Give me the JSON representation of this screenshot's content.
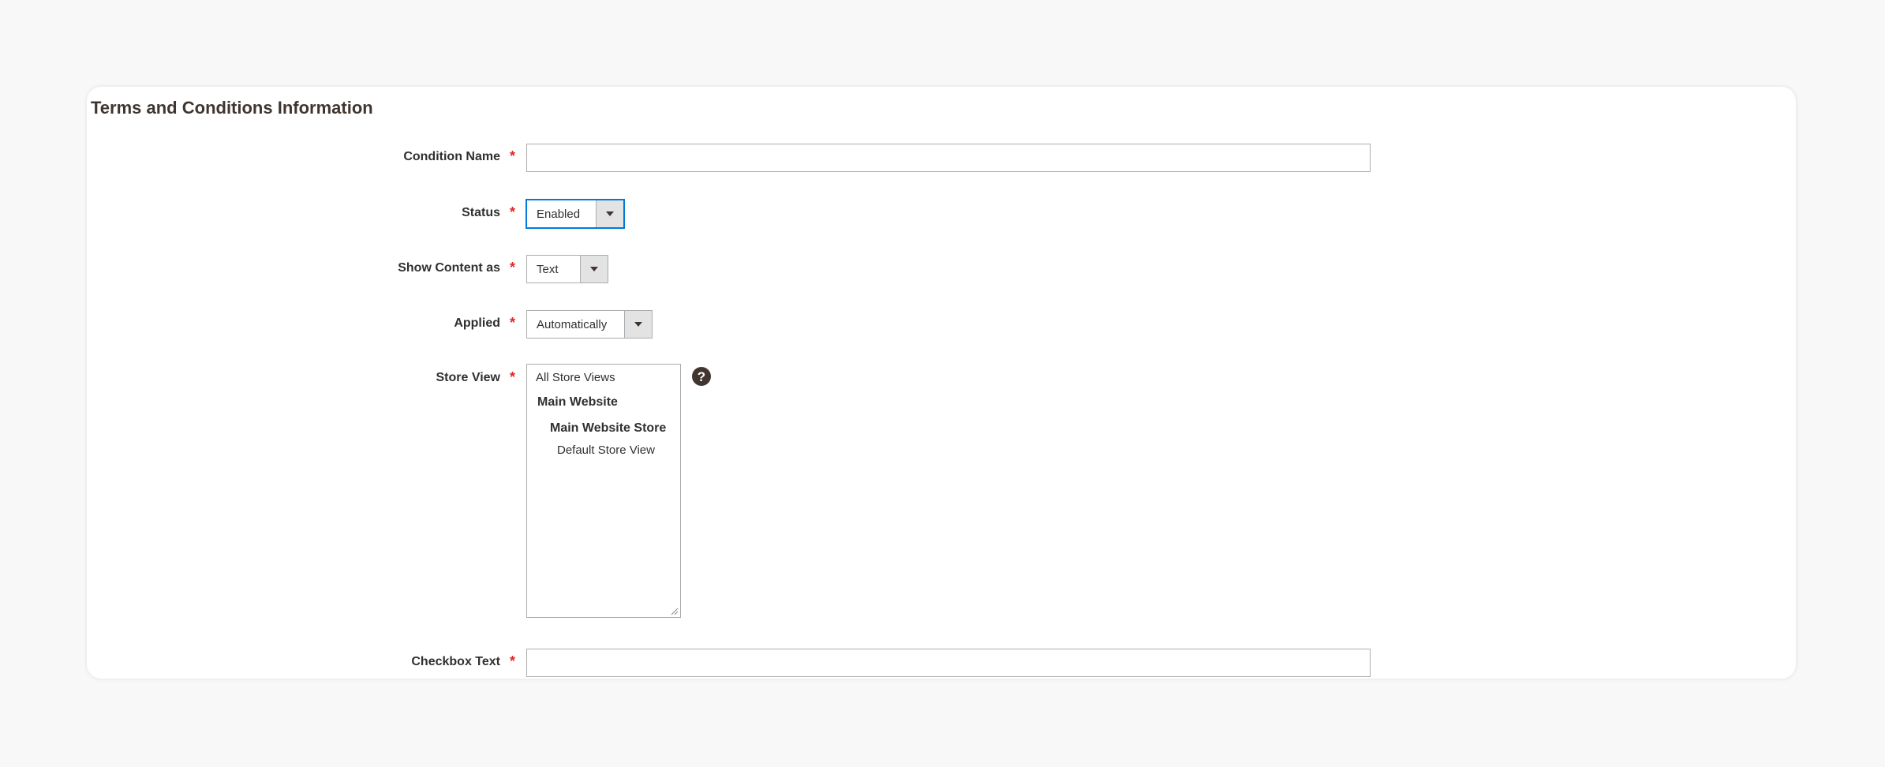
{
  "section": {
    "title": "Terms and Conditions Information"
  },
  "fields": {
    "condition_name": {
      "label": "Condition Name",
      "required_mark": "*",
      "value": ""
    },
    "status": {
      "label": "Status",
      "required_mark": "*",
      "value": "Enabled"
    },
    "show_content_as": {
      "label": "Show Content as",
      "required_mark": "*",
      "value": "Text"
    },
    "applied": {
      "label": "Applied",
      "required_mark": "*",
      "value": "Automatically"
    },
    "store_view": {
      "label": "Store View",
      "required_mark": "*",
      "help": "?",
      "options": [
        "All Store Views",
        "Main Website",
        "Main Website Store",
        "Default Store View"
      ]
    },
    "checkbox_text": {
      "label": "Checkbox Text",
      "required_mark": "*",
      "value": ""
    }
  },
  "colors": {
    "required": "#e22626",
    "focus": "#007bdb",
    "title": "#41362f"
  },
  "icons": {
    "dropdown": "chevron-down-icon",
    "help": "question-mark-icon",
    "resize": "resize-grip-icon"
  }
}
